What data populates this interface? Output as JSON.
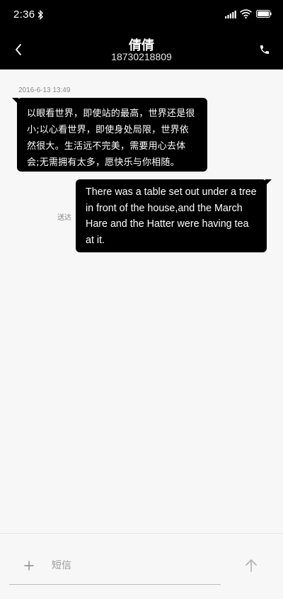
{
  "status_bar": {
    "time": "2:36",
    "icons": [
      "bluetooth-icon",
      "signal-icon",
      "wifi-icon",
      "battery-icon"
    ]
  },
  "header": {
    "contact_name": "倩倩",
    "contact_number": "18730218809",
    "icons": [
      "back-arrow-icon",
      "phone-icon"
    ]
  },
  "conversation": {
    "timestamp": "2016-6-13 13:49",
    "messages": [
      {
        "direction": "incoming",
        "lines": [
          "以眼看世界，即使站的最高，世界还是很",
          "小;以心看世界，即使身处局限，世界依",
          "然很大。生活远不完美，需要用心去体",
          "会;无需拥有太多，愿快乐与你相随。"
        ]
      },
      {
        "direction": "outgoing",
        "lines": [
          "There was a table set out under a tree",
          "in front of the house,and the March",
          "Hare and the Hatter were having tea",
          "at it."
        ],
        "status": "送达"
      }
    ]
  },
  "composer": {
    "placeholder": "短信",
    "value": "",
    "icons": [
      "plus-icon",
      "send-arrow-icon"
    ]
  },
  "colors": {
    "header_background": "#000000",
    "bubble_background": "#000000",
    "bubble_text": "#ffffff",
    "conversation_background": "#f7f7f7",
    "muted_text": "#8a8a8a"
  }
}
